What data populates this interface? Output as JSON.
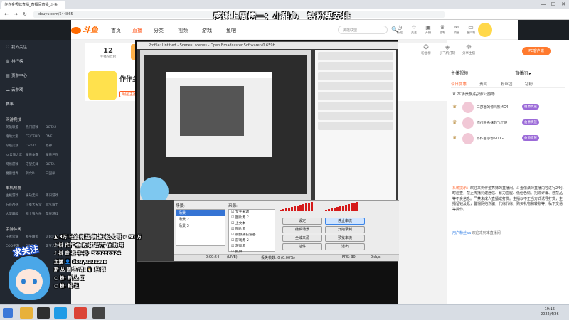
{
  "browser": {
    "tab_title": "作作金秀妹直播_直播间直播_斗鱼",
    "url": "douyu.com/544865",
    "back": "←",
    "forward": "→",
    "reload": "↻",
    "minimize": "—",
    "maximize": "☐",
    "close": "✕"
  },
  "stream_title": "感谢上周榜一：小甜心　钻粉帮安排",
  "header": {
    "logo": "斗鱼",
    "nav": [
      "首页",
      "直播",
      "分类",
      "视频",
      "游戏",
      "鱼吧"
    ],
    "search_placeholder": "英雄联盟",
    "search_icon": "🔍",
    "icons": [
      {
        "glyph": "◷",
        "label": "历史"
      },
      {
        "glyph": "☆",
        "label": "关注"
      },
      {
        "glyph": "▣",
        "label": "开播"
      },
      {
        "glyph": "♛",
        "label": "鱼吧"
      },
      {
        "glyph": "✉",
        "label": "消息"
      },
      {
        "glyph": "▭",
        "label": "客户端"
      }
    ]
  },
  "sidebar": {
    "top_items": [
      {
        "icon": "♡",
        "label": "我的关注"
      },
      {
        "icon": "♛",
        "label": "排行榜"
      },
      {
        "icon": "▦",
        "label": "页游中心"
      },
      {
        "icon": "☁",
        "label": "云游戏"
      }
    ],
    "hot_label": "赛事",
    "sections": [
      {
        "title": "网游竞技",
        "items": [
          "英雄联盟",
          "热门游戏",
          "DOTA2",
          "绝地大逃",
          "CF/CFHD",
          "DNF",
          "穿越火线",
          "CS:GO",
          "原神",
          "lol云顶之弈",
          "魔兽争霸",
          "魔兽世界",
          "网易游戏",
          "守望先锋",
          "DOTA",
          "魔兽世界",
          "洞穴D",
          "三国杀"
        ]
      },
      {
        "title": "单机热游",
        "items": [
          "主机游戏",
          "永劫无间",
          "怀旧游戏",
          "方舟ARK",
          "卫冕大天堂",
          "元气骑士",
          "大型蹦极",
          "网上狼人杀",
          "苹果游戏"
        ]
      },
      {
        "title": "手游休闲",
        "items": [
          "王者荣耀",
          "和平精英",
          "火影忍者",
          "COD手游",
          "QQ飞车",
          "第五人格"
        ]
      }
    ]
  },
  "room": {
    "rank_number": "12",
    "rank_text": "主播粉丝榜",
    "streamer_name": "作作金",
    "streamer_tag": "明星主播"
  },
  "top_icons": [
    {
      "glyph": "❂",
      "label": "粉丝榜"
    },
    {
      "glyph": "◈",
      "label": "小飞机打转"
    },
    {
      "glyph": "☸",
      "label": "分享主播"
    }
  ],
  "pc_button": "PC客户端",
  "chat": {
    "top_left": "主播视频",
    "top_right": "直播间 ▸",
    "tabs": [
      "今日优惠",
      "贵宾",
      "粉丝团",
      "钻粉"
    ],
    "noble_title": "♛ 本场贵族/钻粉/公爵等",
    "nobles": [
      {
        "name": "三部曲的惊鸿熊MG4",
        "tag": "伯爵贵族"
      },
      {
        "name": "作作金秀妹的飞了吧",
        "tag": "伯爵贵族"
      },
      {
        "name": "作作金小郡&LOG",
        "tag": "伯爵贵族"
      }
    ],
    "system_label": "系统提示：",
    "system_msg": "欢迎来到作金秀妹的直播间。斗鱼依法对直播内容进行24小时巡查，禁止传播封建迷信、暴力血腥、低俗色情、招嫖诈骗、违禁品等不良信息。严禁未成人直播或打赏。主播以不正当方式诱导打赏，主播留钱及逛，警惕网络诈骗，代练代练，购买礼物和转账等，私下交易等操作。",
    "welcome_user": "用户粉丝aa",
    "welcome_text": "欢迎来到本直播间"
  },
  "obs": {
    "title": "Profile: Untitled - Scenes: scenes - Open Broadcaster Software v0.659b",
    "scenes_label": "场景:",
    "sources_label": "来源:",
    "scenes": [
      "场景",
      "场景 2",
      "场景 3"
    ],
    "sources": [
      "文字来源",
      "图片源 2",
      "上文本",
      "图片源",
      "视频捕获设备",
      "游戏源 2",
      "游戏源",
      "抓屏"
    ],
    "buttons": {
      "settings": "设定",
      "stop_stream": "停止串流",
      "edit_scene": "编辑场景",
      "start_record": "开始录制",
      "global_source": "全域来源",
      "preview": "预览串流",
      "plugins": "插件",
      "exit": "退出"
    },
    "status_time": "0:00:54",
    "status_mode": "(LIVE)",
    "status_dropped": "丢失帧数: 0 (0.00%)",
    "status_fps": "FPS: 30",
    "status_kbps": "0kb/s"
  },
  "overlay": {
    "follow": "求关注",
    "lines": [
      "▲ 3万 马全 刷 猛 舞 撩 老 大 哥 ≠ 80 万",
      "♪ 抖 作作 金 秀 妹 官 方 位 数 号",
      "♪ 抖 音 抖 手 抖: 589288324",
      "主播 👤 douyuzuozuo",
      "斯 丛 团 各 诵: 🐧 粉 群",
      "○ 粉: 斯 丛 团",
      "○ 粉: 粉 坦"
    ]
  },
  "taskbar": {
    "time": "19:15",
    "date": "2022/4/26"
  },
  "colors": {
    "accent": "#ff5d23",
    "sidebar_bg": "#222831",
    "obs_meter": "#d51a1a"
  }
}
